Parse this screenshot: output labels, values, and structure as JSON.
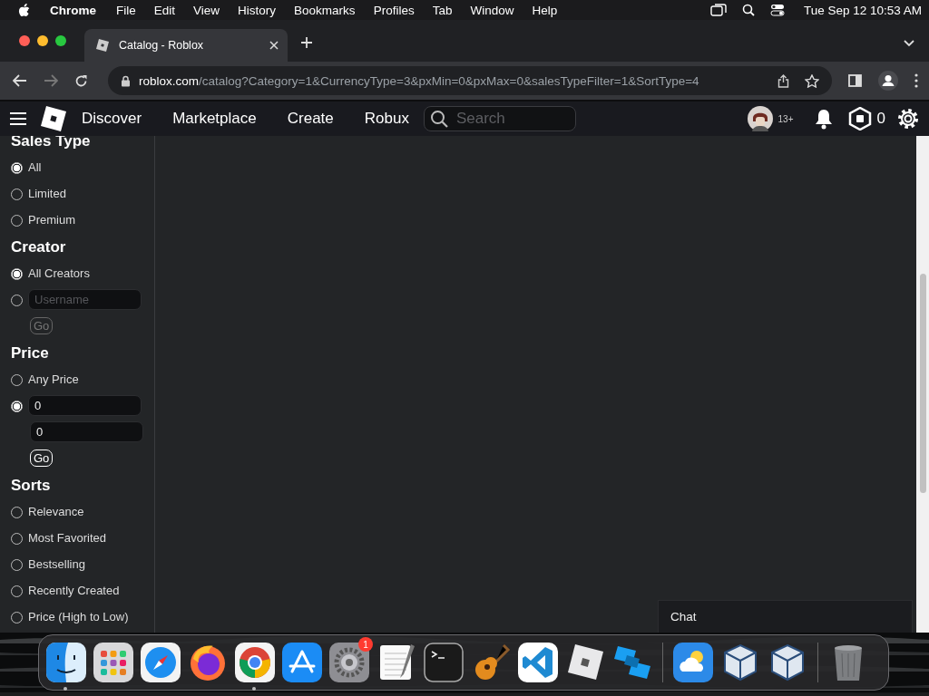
{
  "menu_bar": {
    "app": "Chrome",
    "items": [
      "File",
      "Edit",
      "View",
      "History",
      "Bookmarks",
      "Profiles",
      "Tab",
      "Window",
      "Help"
    ],
    "clock": "Tue Sep 12  10:53 AM"
  },
  "browser": {
    "tabs": [
      {
        "title": "Catalog - Roblox",
        "selected": true
      }
    ],
    "address": {
      "host": "roblox.com",
      "path": "/catalog?Category=1&CurrencyType=3&pxMin=0&pxMax=0&salesTypeFilter=1&SortType=4"
    }
  },
  "nav": {
    "links": [
      "Discover",
      "Marketplace",
      "Create",
      "Robux"
    ],
    "search": {
      "placeholder": "Search"
    },
    "age_badge": "13+",
    "robux_balance": "0"
  },
  "filters": [
    {
      "heading": "Sales Type",
      "options": [
        {
          "kind": "radio",
          "label": "All",
          "selected": true
        },
        {
          "kind": "radio",
          "label": "Limited",
          "selected": false
        },
        {
          "kind": "radio",
          "label": "Premium",
          "selected": false
        }
      ]
    },
    {
      "heading": "Creator",
      "options": [
        {
          "kind": "radio",
          "label": "All Creators",
          "selected": true
        },
        {
          "kind": "radio_input",
          "placeholder": "Username",
          "selected": false
        },
        {
          "kind": "button",
          "label": "Go",
          "disabled": true
        }
      ]
    },
    {
      "heading": "Price",
      "options": [
        {
          "kind": "radio",
          "label": "Any Price",
          "selected": false
        },
        {
          "kind": "radio_input",
          "value": "0",
          "selected": true
        },
        {
          "kind": "input",
          "value": "0"
        },
        {
          "kind": "button",
          "label": "Go",
          "disabled": false
        }
      ]
    },
    {
      "heading": "Sorts",
      "options": [
        {
          "kind": "radio",
          "label": "Relevance",
          "selected": false
        },
        {
          "kind": "radio",
          "label": "Most Favorited",
          "selected": false
        },
        {
          "kind": "radio",
          "label": "Bestselling",
          "selected": false
        },
        {
          "kind": "radio",
          "label": "Recently Created",
          "selected": false
        },
        {
          "kind": "radio",
          "label": "Price (High to Low)",
          "selected": false
        }
      ]
    }
  ],
  "chat": {
    "title": "Chat"
  },
  "dock": [
    {
      "kind": "finder",
      "running": true
    },
    {
      "kind": "launchpad",
      "running": false
    },
    {
      "kind": "safari",
      "running": false
    },
    {
      "kind": "firefox",
      "running": false
    },
    {
      "kind": "chrome",
      "running": true
    },
    {
      "kind": "appstore",
      "running": false
    },
    {
      "kind": "settings",
      "running": false,
      "badge": "1"
    },
    {
      "kind": "textedit",
      "running": false
    },
    {
      "kind": "terminal",
      "running": false
    },
    {
      "kind": "guitar",
      "running": false
    },
    {
      "kind": "vscode",
      "running": false
    },
    {
      "kind": "roblox",
      "running": false
    },
    {
      "kind": "studio",
      "running": false
    },
    {
      "kind": "separator"
    },
    {
      "kind": "weather",
      "running": false
    },
    {
      "kind": "cube",
      "running": false
    },
    {
      "kind": "cube",
      "running": false
    },
    {
      "kind": "separator"
    },
    {
      "kind": "trash",
      "running": false
    }
  ]
}
